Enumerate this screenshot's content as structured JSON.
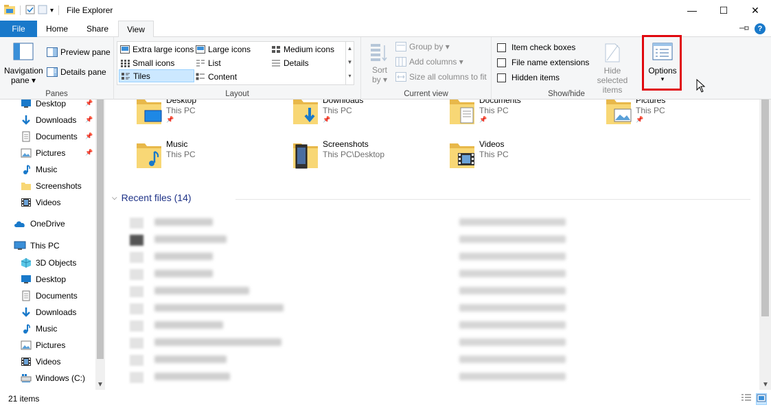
{
  "window": {
    "title": "File Explorer",
    "controls": {
      "minimize": "—",
      "maximize": "☐",
      "close": "✕"
    }
  },
  "quick_access_toolbar": {
    "dropdown": "▾"
  },
  "tabs": [
    {
      "label": "File"
    },
    {
      "label": "Home"
    },
    {
      "label": "Share"
    },
    {
      "label": "View"
    }
  ],
  "ribbon": {
    "panes": {
      "group_label": "Panes",
      "navigation_pane": "Navigation",
      "navigation_pane_line2": "pane ▾",
      "preview_pane": "Preview pane",
      "details_pane": "Details pane"
    },
    "layout": {
      "group_label": "Layout",
      "items": {
        "extra_large_icons": "Extra large icons",
        "large_icons": "Large icons",
        "medium_icons": "Medium icons",
        "small_icons": "Small icons",
        "list": "List",
        "details": "Details",
        "tiles": "Tiles",
        "content": "Content"
      }
    },
    "current_view": {
      "group_label": "Current view",
      "sort_by": "Sort",
      "sort_by_line2": "by ▾",
      "group_by": "Group by ▾",
      "add_columns": "Add columns ▾",
      "size_all_columns": "Size all columns to fit"
    },
    "show_hide": {
      "group_label": "Show/hide",
      "item_check_boxes": "Item check boxes",
      "file_name_extensions": "File name extensions",
      "hidden_items": "Hidden items",
      "hide_selected": "Hide selected",
      "hide_selected_line2": "items",
      "options": "Options",
      "options_arrow": "▾"
    }
  },
  "navigation": {
    "quick_access": [
      {
        "label": "Desktop",
        "icon": "desktop-icon"
      },
      {
        "label": "Downloads",
        "icon": "downloads-icon"
      },
      {
        "label": "Documents",
        "icon": "documents-icon"
      },
      {
        "label": "Pictures",
        "icon": "pictures-icon"
      },
      {
        "label": "Music",
        "icon": "music-icon"
      },
      {
        "label": "Screenshots",
        "icon": "folder-icon"
      },
      {
        "label": "Videos",
        "icon": "videos-icon"
      }
    ],
    "onedrive": "OneDrive",
    "this_pc": "This PC",
    "this_pc_items": [
      {
        "label": "3D Objects",
        "icon": "3d-objects-icon"
      },
      {
        "label": "Desktop",
        "icon": "desktop-icon"
      },
      {
        "label": "Documents",
        "icon": "documents-icon"
      },
      {
        "label": "Downloads",
        "icon": "downloads-icon"
      },
      {
        "label": "Music",
        "icon": "music-icon"
      },
      {
        "label": "Pictures",
        "icon": "pictures-icon"
      },
      {
        "label": "Videos",
        "icon": "videos-icon"
      },
      {
        "label": "Windows (C:)",
        "icon": "drive-icon"
      }
    ]
  },
  "folders": [
    {
      "name": "Desktop",
      "location": "This PC",
      "pinned": true
    },
    {
      "name": "Downloads",
      "location": "This PC",
      "pinned": true
    },
    {
      "name": "Documents",
      "location": "This PC",
      "pinned": true
    },
    {
      "name": "Pictures",
      "location": "This PC",
      "pinned": true
    },
    {
      "name": "Music",
      "location": "This PC",
      "pinned": false
    },
    {
      "name": "Screenshots",
      "location": "This PC\\Desktop",
      "pinned": false
    },
    {
      "name": "Videos",
      "location": "This PC",
      "pinned": false
    }
  ],
  "recent_files": {
    "header": "Recent files (14)"
  },
  "status": {
    "item_count": "21 items"
  },
  "colors": {
    "accent": "#1979ca",
    "folder_yellow": "#f8d775",
    "folder_dark": "#e8b84a",
    "highlight_red": "#e0080e",
    "selection": "#cce8ff"
  }
}
